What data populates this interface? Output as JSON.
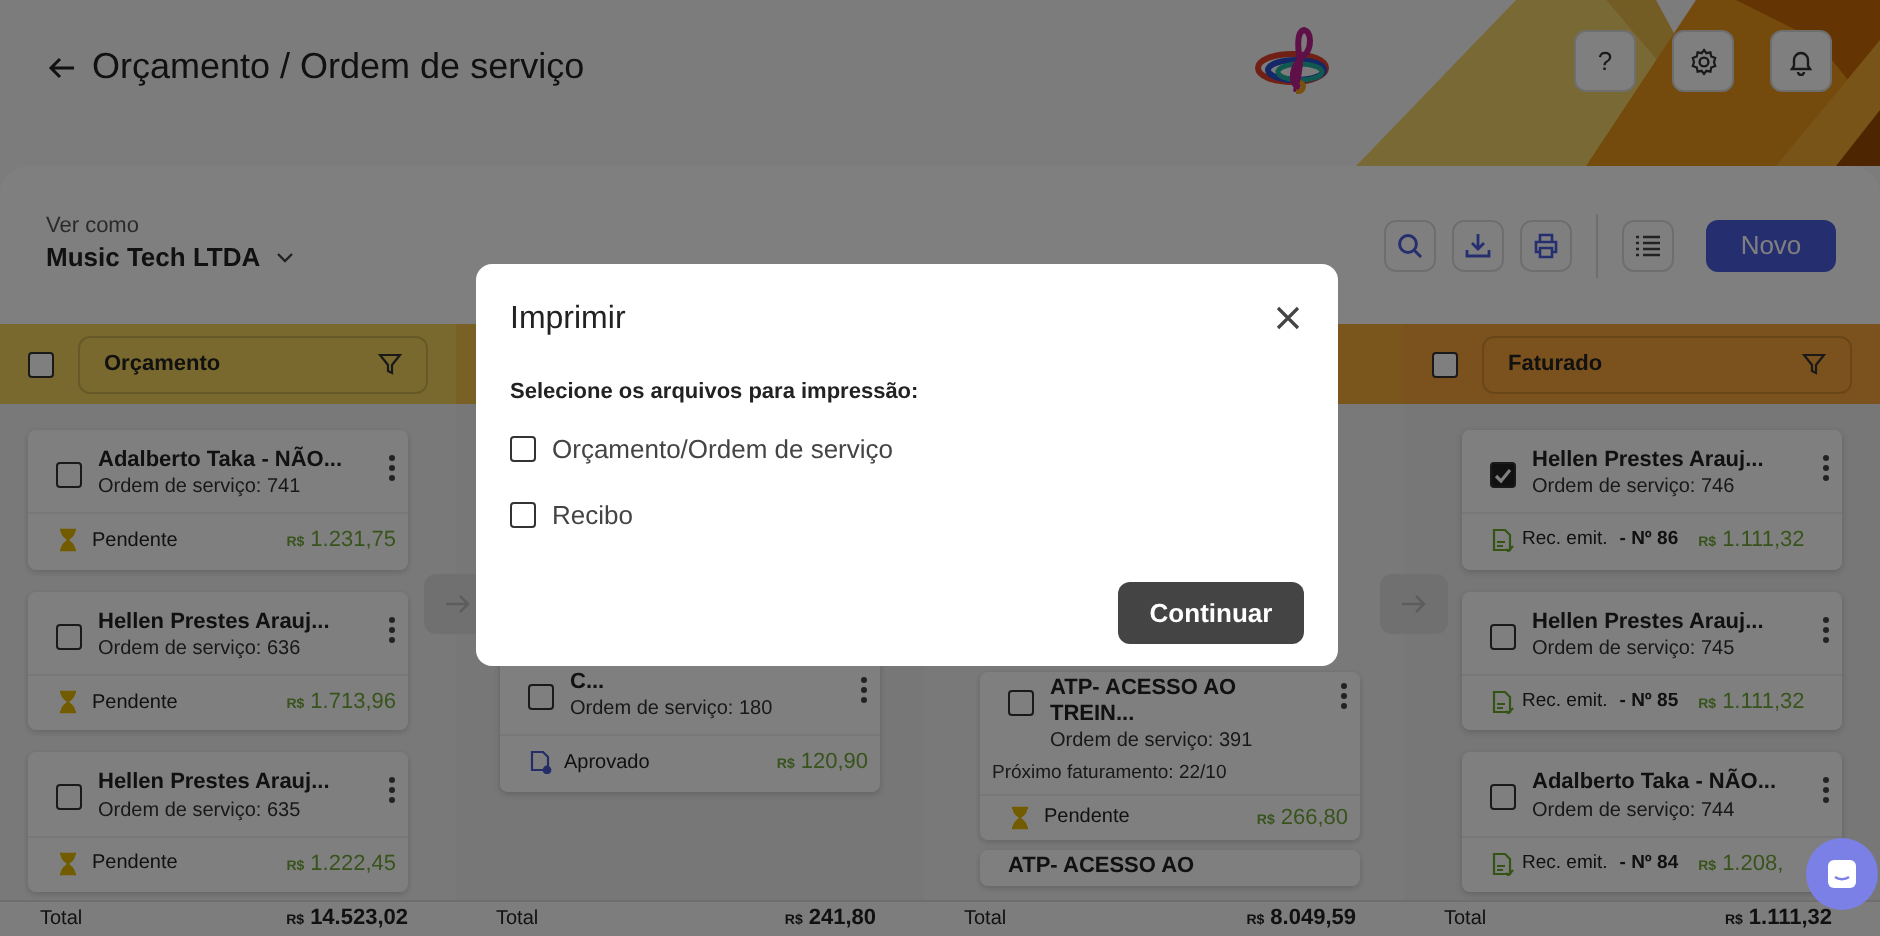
{
  "header": {
    "title": "Orçamento / Ordem de serviço",
    "help_label": "?"
  },
  "toolbar": {
    "view_as_label": "Ver como",
    "company": "Music Tech LTDA",
    "new_button": "Novo"
  },
  "columns": [
    {
      "title": "Orçamento",
      "checked": false,
      "total_label": "Total",
      "total_currency": "R$",
      "total": "14.523,02",
      "cards": [
        {
          "title": "Adalberto Taka - NÃO...",
          "subtitle": "Ordem de serviço: 741",
          "checked": false,
          "status": {
            "kind": "pending",
            "label": "Pendente"
          },
          "currency": "R$",
          "amount": "1.231,75"
        },
        {
          "title": "Hellen Prestes Arauj...",
          "subtitle": "Ordem de serviço: 636",
          "checked": false,
          "status": {
            "kind": "pending",
            "label": "Pendente"
          },
          "currency": "R$",
          "amount": "1.713,96"
        },
        {
          "title": "Hellen Prestes Arauj...",
          "subtitle": "Ordem de serviço: 635",
          "checked": false,
          "status": {
            "kind": "pending",
            "label": "Pendente"
          },
          "currency": "R$",
          "amount": "1.222,45"
        }
      ]
    },
    {
      "total_label": "Total",
      "total_currency": "R$",
      "total": "241,80",
      "cards": [
        {
          "title": "C...",
          "subtitle": "Ordem de serviço: 180",
          "checked": false,
          "status": {
            "kind": "approved",
            "label": "Aprovado"
          },
          "currency": "R$",
          "amount": "120,90"
        }
      ]
    },
    {
      "total_label": "Total",
      "total_currency": "R$",
      "total": "8.049,59",
      "cards": [
        {
          "title": "ATP- ACESSO AO TREIN...",
          "subtitle": "Ordem de serviço: 391",
          "note": "Próximo faturamento: 22/10",
          "checked": false,
          "status": {
            "kind": "pending",
            "label": "Pendente"
          },
          "currency": "R$",
          "amount": "266,80"
        },
        {
          "title": "ATP- ACESSO AO"
        }
      ]
    },
    {
      "title": "Faturado",
      "checked": false,
      "total_label": "Total",
      "total_currency": "R$",
      "total": "1.111,32",
      "cards": [
        {
          "title": "Hellen Prestes Arauj...",
          "subtitle": "Ordem de serviço: 746",
          "checked": true,
          "status": {
            "kind": "receipt",
            "label": "Rec. emit.",
            "number": "- Nº 86"
          },
          "currency": "R$",
          "amount": "1.111,32"
        },
        {
          "title": "Hellen Prestes Arauj...",
          "subtitle": "Ordem de serviço: 745",
          "checked": false,
          "status": {
            "kind": "receipt",
            "label": "Rec. emit.",
            "number": "- Nº 85"
          },
          "currency": "R$",
          "amount": "1.111,32"
        },
        {
          "title": "Adalberto Taka - NÃO...",
          "subtitle": "Ordem de serviço: 744",
          "checked": false,
          "status": {
            "kind": "receipt",
            "label": "Rec. emit.",
            "number": "- Nº 84"
          },
          "currency": "R$",
          "amount": "1.208,"
        }
      ]
    }
  ],
  "dialog": {
    "title": "Imprimir",
    "prompt": "Selecione os arquivos para impressão:",
    "options": [
      {
        "label": "Orçamento/Ordem de serviço",
        "checked": false
      },
      {
        "label": "Recibo",
        "checked": false
      }
    ],
    "button": "Continuar"
  }
}
